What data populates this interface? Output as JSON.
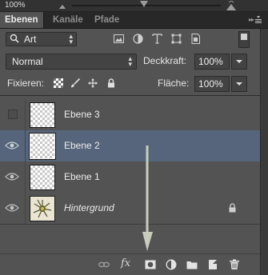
{
  "top_strip": {
    "zoom_text": "100%"
  },
  "tabs": [
    {
      "label": "Ebenen",
      "active": true
    },
    {
      "label": "Kanäle",
      "active": false
    },
    {
      "label": "Pfade",
      "active": false
    }
  ],
  "filter": {
    "type_label": "Art",
    "toggle_on": true
  },
  "blend": {
    "mode": "Normal",
    "opacity_label": "Deckkraft:",
    "opacity_value": "100%"
  },
  "lock": {
    "label": "Fixieren:",
    "fill_label": "Fläche:",
    "fill_value": "100%"
  },
  "layers": [
    {
      "name": "Ebene 3",
      "visible": false,
      "selected": false,
      "kind": "transparent"
    },
    {
      "name": "Ebene 2",
      "visible": true,
      "selected": true,
      "kind": "transparent"
    },
    {
      "name": "Ebene 1",
      "visible": true,
      "selected": false,
      "kind": "transparent"
    },
    {
      "name": "Hintergrund",
      "visible": true,
      "selected": false,
      "kind": "background",
      "locked": true
    }
  ],
  "bottom_icons": [
    "link-icon",
    "fx-icon",
    "add-mask-icon",
    "adjustment-layer-icon",
    "new-group-icon",
    "new-layer-icon",
    "delete-icon"
  ],
  "bottom_fx_label": "fx",
  "colors": {
    "panel_bg": "#535353",
    "selected_bg": "#56657b",
    "arrow": "#c8cdbb"
  }
}
